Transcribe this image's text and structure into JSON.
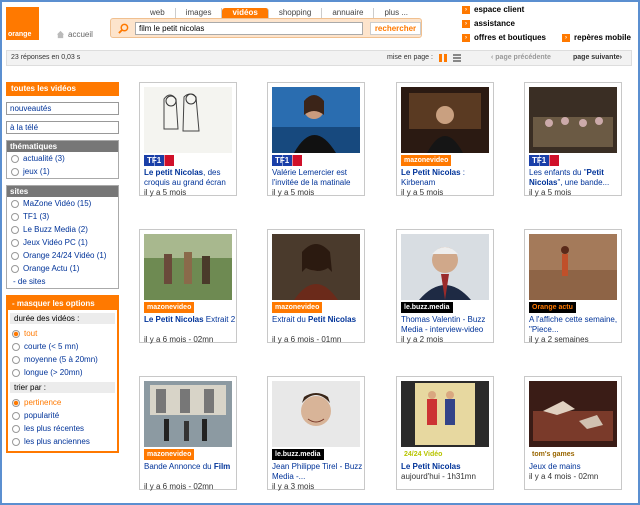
{
  "header": {
    "logo_text": "orange",
    "home_label": "accueil",
    "tabs": [
      "web",
      "images",
      "vidéos",
      "shopping",
      "annuaire",
      "plus ..."
    ],
    "search_value": "film le petit nicolas",
    "search_button": "rechercher",
    "links": [
      "espace client",
      "assistance",
      "offres et boutiques",
      "repères mobile"
    ]
  },
  "results": {
    "count": "23 réponses en 0,03 s",
    "mise_en_page": "mise en page :",
    "prev": "‹ page précédente",
    "next": "page suivante›"
  },
  "sidebar": {
    "all_videos": "toutes les vidéos",
    "nouveautes": "nouveautés",
    "tele": "à la télé",
    "themes_title": "thématiques",
    "themes": [
      "actualité (3)",
      "jeux (1)"
    ],
    "sites_title": "sites",
    "sites": [
      "MaZone Vidéo (15)",
      "TF1 (3)",
      "Le Buzz Media (2)",
      "Jeux Vidéo PC (1)",
      "Orange 24/24 Vidéo (1)",
      "Orange Actu (1)"
    ],
    "more_sites": "- de sites",
    "options_title": "- masquer les options",
    "duree_title": "durée des vidéos :",
    "duree": [
      "tout",
      "courte (< 5 mn)",
      "moyenne (5 à 20mn)",
      "longue (> 20mn)"
    ],
    "trier_title": "trier par :",
    "trier": [
      "pertinence",
      "popularité",
      "les plus récentes",
      "les plus anciennes"
    ]
  },
  "videos": [
    {
      "brand": "TF1",
      "title_pre": "",
      "title_bold": "Le petit Nicolas",
      "title_post": ", des croquis au grand écran",
      "meta": "il y a 5 mois"
    },
    {
      "brand": "TF1",
      "title_pre": "Valérie Lemercier est l'invitée de la matinale",
      "title_bold": "",
      "title_post": "",
      "meta": "il y a 5 mois"
    },
    {
      "brand": "mazonevideo",
      "title_pre": "",
      "title_bold": "Le Petit Nicolas",
      "title_post": " : Kirbenam",
      "meta": "il y a 5 mois"
    },
    {
      "brand": "TF1",
      "title_pre": "Les enfants du \"",
      "title_bold": "Petit Nicolas",
      "title_post": "\", une bande...",
      "meta": "il y a 5 mois"
    },
    {
      "brand": "mazonevideo",
      "title_pre": "",
      "title_bold": "Le Petit Nicolas",
      "title_post": " Extrait 2",
      "meta": "il y a 6 mois - 02mn"
    },
    {
      "brand": "mazonevideo",
      "title_pre": "Extrait du ",
      "title_bold": "Petit Nicolas",
      "title_post": "",
      "meta": "il y a 6 mois - 01mn"
    },
    {
      "brand": "le.buzz.media",
      "title_pre": "Thomas Valentin - Buzz Media - interview-video",
      "title_bold": "",
      "title_post": "",
      "meta": "il y a 2 mois"
    },
    {
      "brand": "Orange actu",
      "title_pre": "A l'affiche cette semaine, \"Piece...",
      "title_bold": "",
      "title_post": "",
      "meta": "il y a 2 semaines"
    },
    {
      "brand": "mazonevideo",
      "title_pre": "Bande Annonce du ",
      "title_bold": "Film",
      "title_post": "",
      "meta": "il y a 6 mois - 02mn"
    },
    {
      "brand": "le.buzz.media",
      "title_pre": "Jean Philippe Tirel - Buzz Media -...",
      "title_bold": "",
      "title_post": "",
      "meta": "il y a 3 mois"
    },
    {
      "brand": "24/24 Vidéo",
      "title_pre": "",
      "title_bold": "Le Petit Nicolas",
      "title_post": "",
      "meta": "aujourd'hui - 1h31mn"
    },
    {
      "brand": "tom's games",
      "title_pre": "Jeux de mains",
      "title_bold": "",
      "title_post": "",
      "meta": "il y a 4 mois - 02mn"
    }
  ]
}
